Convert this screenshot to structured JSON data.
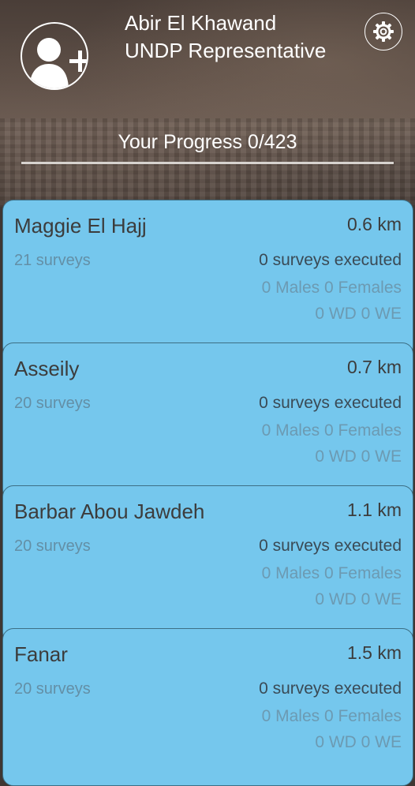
{
  "user": {
    "name": "Abir El Khawand",
    "role": "UNDP Representative"
  },
  "icons": {
    "avatar": "person-add-icon",
    "settings": "gear-icon"
  },
  "progress": {
    "label": "Your Progress 0/423",
    "completed": 0,
    "total": 423,
    "fraction": 0
  },
  "colors": {
    "card_background": "#75c7ed",
    "primary_text": "#3c3c3c",
    "muted_text": "#6c9ab2"
  },
  "locations": [
    {
      "name": "Maggie El Hajj",
      "distance": "0.6 km",
      "surveys": "21 surveys",
      "executed": "0 surveys executed",
      "gender": "0 Males 0 Females",
      "days": "0 WD 0 WE"
    },
    {
      "name": "Asseily",
      "distance": "0.7 km",
      "surveys": "20 surveys",
      "executed": "0 surveys executed",
      "gender": "0 Males 0 Females",
      "days": "0 WD 0 WE"
    },
    {
      "name": "Barbar Abou Jawdeh",
      "distance": "1.1 km",
      "surveys": "20 surveys",
      "executed": "0 surveys executed",
      "gender": "0 Males 0 Females",
      "days": "0 WD 0 WE"
    },
    {
      "name": "Fanar",
      "distance": "1.5 km",
      "surveys": "20 surveys",
      "executed": "0 surveys executed",
      "gender": "0 Males 0 Females",
      "days": "0 WD 0 WE"
    }
  ]
}
